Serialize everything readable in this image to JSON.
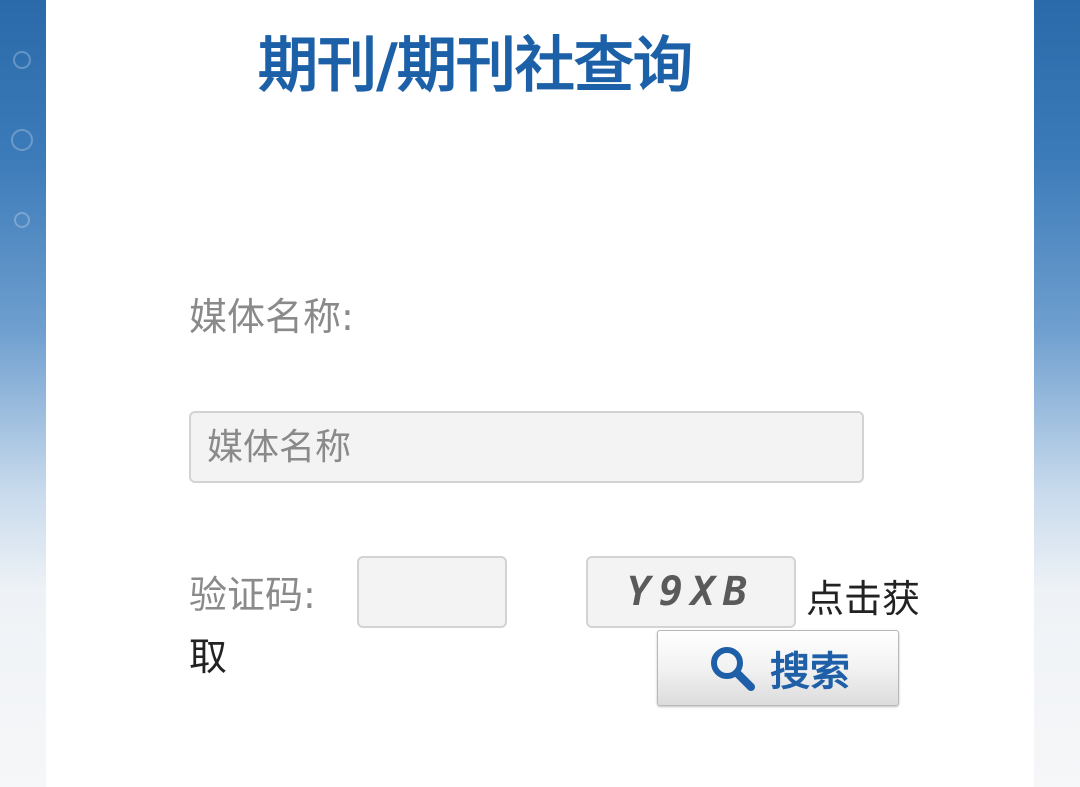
{
  "header": {
    "title": "期刊/期刊社查询"
  },
  "form": {
    "media_name": {
      "label": "媒体名称:",
      "placeholder": "媒体名称",
      "value": ""
    },
    "verify_code": {
      "label": "验证码:",
      "value": ""
    },
    "captcha": {
      "text": "Y9XB",
      "refresh_text_line1": "点击获",
      "refresh_text_line2": "取"
    },
    "search_button": {
      "label": "搜索",
      "icon": "magnifier-icon"
    }
  },
  "colors": {
    "title": "#1c60a8",
    "label": "#8a8a8a",
    "side_band_top": "#2a6aaa",
    "button_text": "#1e5fa8"
  }
}
